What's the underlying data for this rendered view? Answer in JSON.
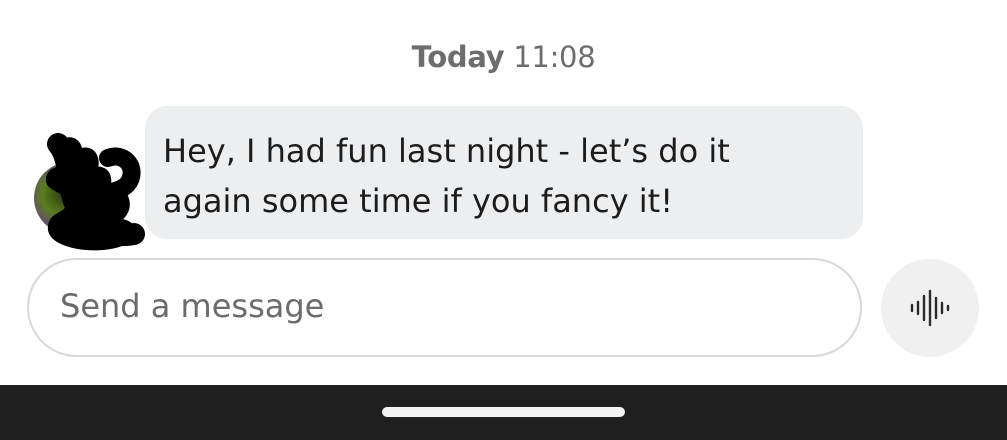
{
  "conversation": {
    "timestamp_day": "Today",
    "timestamp_time": "11:08",
    "message": {
      "line1": "Hey, I had fun last night - let’s do it",
      "line2": "again some time if you fancy it!"
    }
  },
  "composer": {
    "placeholder": "Send a message",
    "voice_icon": "audio-waveform-icon"
  },
  "colors": {
    "bubble_bg": "#edeef0",
    "nav_bar": "#1f1f1f",
    "timestamp": "#6d6d6d"
  }
}
